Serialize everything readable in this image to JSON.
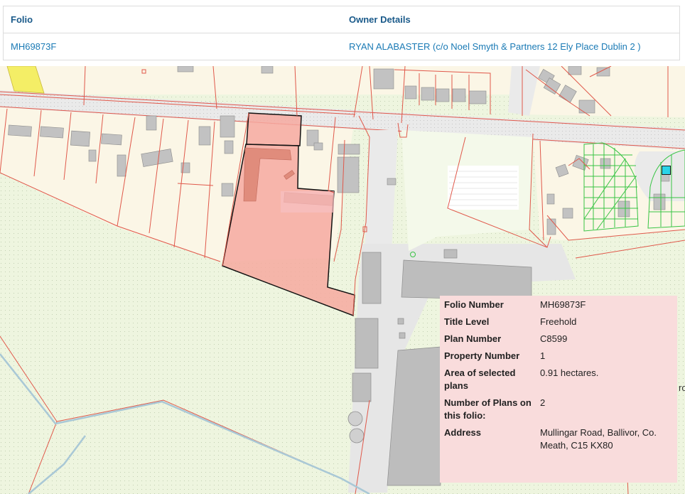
{
  "table": {
    "headers": {
      "folio": "Folio",
      "owner": "Owner Details"
    },
    "row": {
      "folio": "MH69873F",
      "owner": "RYAN ALABASTER (c/o Noel Smyth & Partners 12 Ely Place Dublin 2 )"
    }
  },
  "popup": {
    "rows": [
      {
        "label": "Folio Number",
        "value": "MH69873F"
      },
      {
        "label": "Title Level",
        "value": "Freehold"
      },
      {
        "label": "Plan Number",
        "value": "C8599"
      },
      {
        "label": "Property Number",
        "value": "1"
      },
      {
        "label": "Area of selected plans",
        "value": "0.91 hectares."
      },
      {
        "label": "Number of Plans on this folio:",
        "value": "2"
      },
      {
        "label": "Address",
        "value": "Mullingar Road, Ballivor, Co. Meath, C15 KX80"
      }
    ]
  },
  "map": {
    "edge_text": "ro",
    "colors": {
      "parcel_line": "#e0584a",
      "selected_fill": "#f3a699",
      "selected_outline": "#111111",
      "green_field": "#eef5df",
      "grey_road": "#dadada",
      "hatch": "#38c444",
      "highlight": "#f4ee66",
      "marker": "#2ad4e8"
    }
  }
}
